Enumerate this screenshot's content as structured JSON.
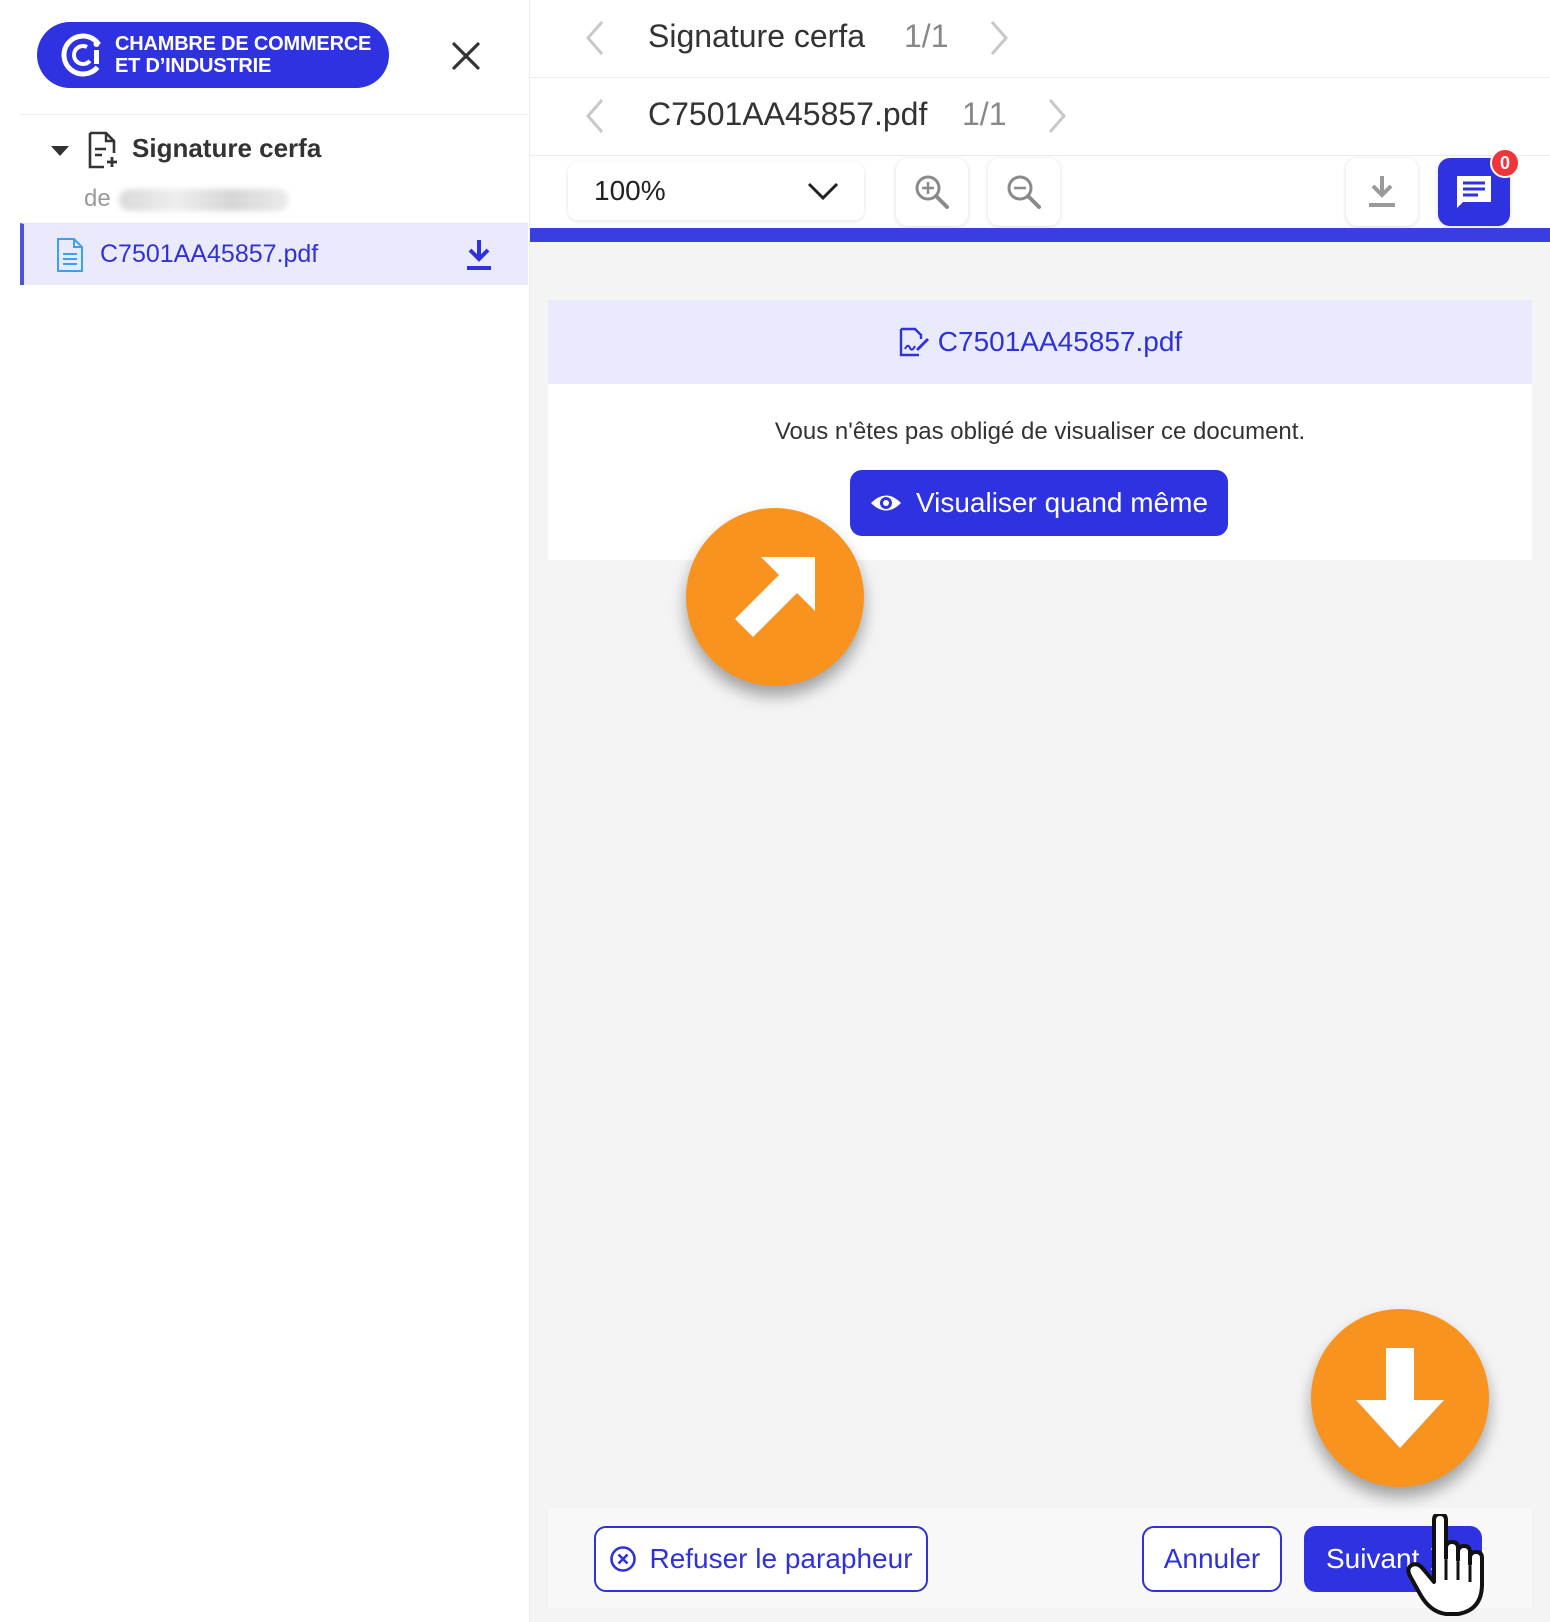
{
  "brand": {
    "line1": "CHAMBRE DE COMMERCE",
    "line2": "ET D’INDUSTRIE",
    "color": "#2e32e0"
  },
  "sidebar": {
    "tree_title": "Signature cerfa",
    "from_label": "de",
    "file_name": "C7501AA45857.pdf"
  },
  "nav": {
    "row1": {
      "title": "Signature cerfa",
      "count": "1/1"
    },
    "row2": {
      "title": "C7501AA45857.pdf",
      "count": "1/1"
    }
  },
  "toolbar": {
    "zoom_value": "100%",
    "comments_count": "0"
  },
  "document": {
    "file_name": "C7501AA45857.pdf",
    "message": "Vous n'êtes pas obligé de visualiser ce document.",
    "view_button": "Visualiser quand même"
  },
  "footer": {
    "refuse_button": "Refuser le parapheur",
    "cancel_button": "Annuler",
    "next_button": "Suivant"
  },
  "colors": {
    "accent": "#2e32e0",
    "callout": "#f7931e",
    "badge": "#f0353a"
  }
}
